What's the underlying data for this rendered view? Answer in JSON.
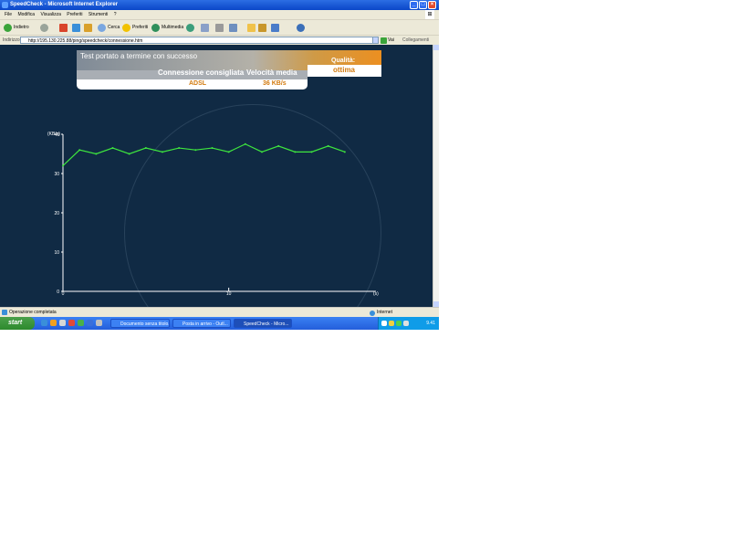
{
  "window": {
    "title": "SpeedCheck - Microsoft Internet Explorer"
  },
  "menu": [
    "File",
    "Modifica",
    "Visualizza",
    "Preferiti",
    "Strumenti",
    "?"
  ],
  "toolbar": {
    "back": "Indietro",
    "search": "Cerca",
    "favorites": "Preferiti",
    "media": "Multimedia"
  },
  "address": {
    "label": "Indirizzo",
    "url": "http://195.130.225.88/ping/speedcheck/connessione.htm",
    "go": "Vai",
    "links": "Collegamenti"
  },
  "result": {
    "title": "Test portato a termine con successo",
    "col_connection": "Connessione consigliata",
    "col_speed": "Velocità media",
    "connection_value": "ADSL",
    "speed_value": "36 KB/s",
    "quality_label": "Qualità:",
    "quality_value": "ottima"
  },
  "chart_data": {
    "type": "line",
    "ylabel": "(KB/s)",
    "xlabel": "(s)",
    "y_ticks": [
      "40",
      "30",
      "20",
      "10",
      "0"
    ],
    "x_ticks": [
      "0",
      "10"
    ],
    "ylim": [
      0,
      40
    ],
    "xlim": [
      0,
      18
    ],
    "series": [
      {
        "color": "#3ee63e",
        "x": [
          0,
          1,
          2,
          3,
          4,
          5,
          6,
          7,
          8,
          9,
          10,
          11,
          12,
          13,
          14,
          15,
          16,
          17
        ],
        "y": [
          32,
          36,
          35,
          36.5,
          35,
          36.5,
          35.5,
          36.5,
          36,
          36.5,
          35.5,
          37.5,
          35.5,
          37,
          35.5,
          35.5,
          37,
          35.5
        ]
      }
    ]
  },
  "status": {
    "text": "Operazione completata",
    "zone": "Internet"
  },
  "taskbar": {
    "start": "start",
    "tasks": [
      "Documento senza titolo...",
      "Posta in arrivo - Outl...",
      "SpeedCheck - Micro..."
    ],
    "clock": "9.41"
  }
}
